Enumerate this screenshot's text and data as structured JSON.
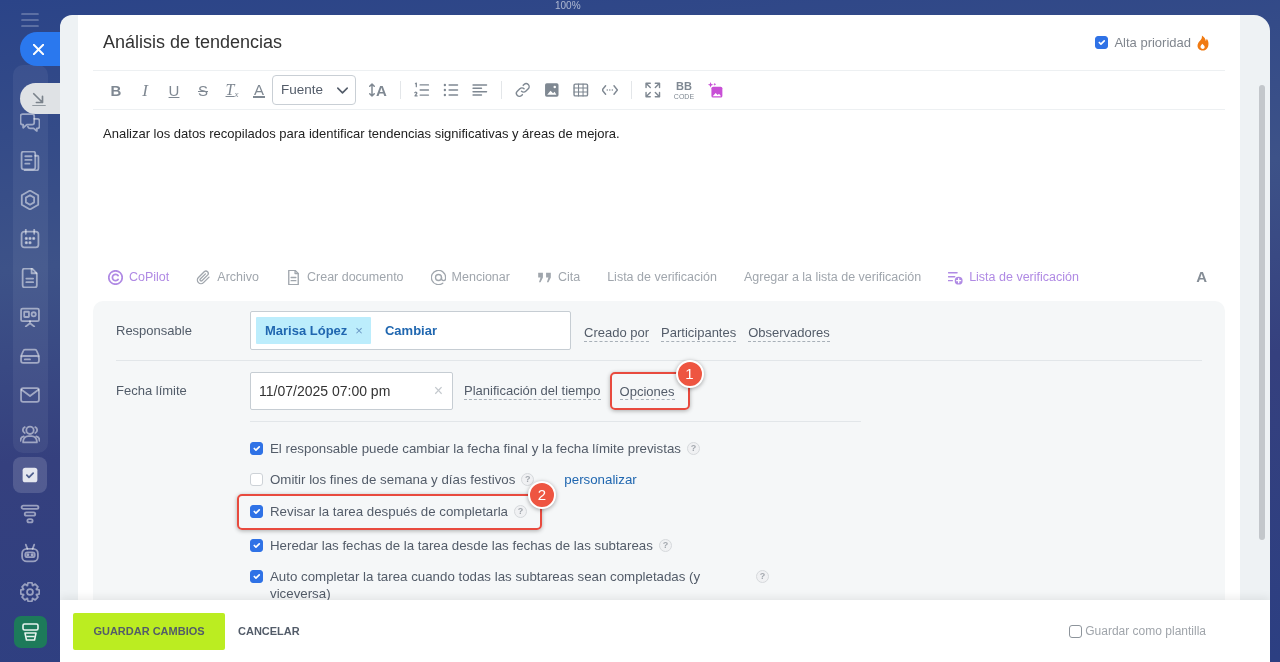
{
  "zoom_label": "100%",
  "sidebar": {
    "group": [
      {
        "kind": "chat",
        "selected": false
      },
      {
        "kind": "feed",
        "selected": false
      },
      {
        "kind": "hexagon",
        "selected": false
      },
      {
        "kind": "calendar",
        "selected": false
      },
      {
        "kind": "document",
        "selected": false
      },
      {
        "kind": "board",
        "selected": false
      },
      {
        "kind": "drive",
        "selected": false
      },
      {
        "kind": "mail",
        "selected": false
      },
      {
        "kind": "contacts",
        "selected": false
      }
    ],
    "items": [
      {
        "kind": "tasks",
        "selected": true
      },
      {
        "kind": "funnel",
        "selected": false
      },
      {
        "kind": "robot",
        "selected": false
      },
      {
        "kind": "settings",
        "selected": false
      },
      {
        "kind": "app",
        "selected": false
      }
    ]
  },
  "task": {
    "title": "Análisis de tendencias",
    "priority": {
      "label": "Alta prioridad",
      "checked": true
    }
  },
  "editor": {
    "toolbar": [
      {
        "kind": "bold",
        "glyph": "B"
      },
      {
        "kind": "italic",
        "glyph": "I"
      },
      {
        "kind": "underline",
        "glyph": "U"
      },
      {
        "kind": "strike",
        "glyph": "S"
      },
      {
        "kind": "clear",
        "glyph": "T$_{x}$"
      },
      {
        "kind": "color",
        "glyph": "A"
      },
      {
        "kind": "select",
        "label": "Fuente"
      },
      {
        "kind": "size",
        "glyph": "A"
      },
      {
        "kind": "separator"
      },
      {
        "kind": "ordered"
      },
      {
        "kind": "bullets"
      },
      {
        "kind": "align"
      },
      {
        "kind": "separator"
      },
      {
        "kind": "link"
      },
      {
        "kind": "image"
      },
      {
        "kind": "table"
      },
      {
        "kind": "code"
      },
      {
        "kind": "separator"
      },
      {
        "kind": "fullscreen"
      },
      {
        "kind": "bbcode",
        "glyph": "BB",
        "caption": "CODE"
      },
      {
        "kind": "ai_image"
      }
    ],
    "text": "Analizar los datos recopilados para identificar tendencias significativas y áreas de mejora."
  },
  "attachments_bar": {
    "items": [
      {
        "kind": "copilot",
        "label": "CoPilot",
        "color": "#b08ae4"
      },
      {
        "kind": "attach",
        "label": "Archivo",
        "color": "#a0a6ad"
      },
      {
        "kind": "document",
        "label": "Crear documento",
        "color": "#a0a6ad"
      },
      {
        "kind": "mention",
        "label": "Mencionar",
        "color": "#a0a6ad"
      },
      {
        "kind": "quote",
        "label": "Cita",
        "color": "#a0a6ad"
      },
      {
        "kind": "plain",
        "label": "Lista de verificación",
        "color": "#a0a6ad"
      },
      {
        "kind": "plain",
        "label": "Agregar a la lista de verificación",
        "color": "#a0a6ad"
      },
      {
        "kind": "checklist",
        "label": "Lista de verificación",
        "color": "#b08ae4"
      }
    ],
    "format_toggle": "A"
  },
  "fields": {
    "responsible": {
      "label": "Responsable",
      "chips": [
        {
          "name": "Marisa López",
          "remove": "×"
        }
      ],
      "action": "Cambiar",
      "links": [
        "Creado por",
        "Participantes",
        "Observadores"
      ]
    },
    "deadline": {
      "label": "Fecha límite",
      "value": "11/07/2025 07:00 pm",
      "clear": "×",
      "links": [
        {
          "label": "Planificación del tiempo"
        },
        {
          "label": "Opciones",
          "callout": "1"
        }
      ]
    },
    "options": [
      {
        "label": "El responsable puede cambiar la fecha final y la fecha límite previstas",
        "checked": true,
        "help": "?"
      },
      {
        "label": "Omitir los fines de semana y días festivos",
        "checked": false,
        "help": "?",
        "link": "personalizar"
      },
      {
        "label": "Revisar la tarea después de completarla",
        "checked": true,
        "help": "?",
        "callout": "2"
      },
      {
        "label": "Heredar las fechas de la tarea desde las fechas de las subtareas",
        "checked": true,
        "help": "?"
      },
      {
        "label": "Auto completar la tarea cuando todas las subtareas sean completadas (y viceversa)",
        "checked": true,
        "help": "?"
      }
    ]
  },
  "footer": {
    "save": "GUARDAR CAMBIOS",
    "cancel": "CANCELAR",
    "template": {
      "label": "Guardar como plantilla",
      "checked": false
    }
  }
}
